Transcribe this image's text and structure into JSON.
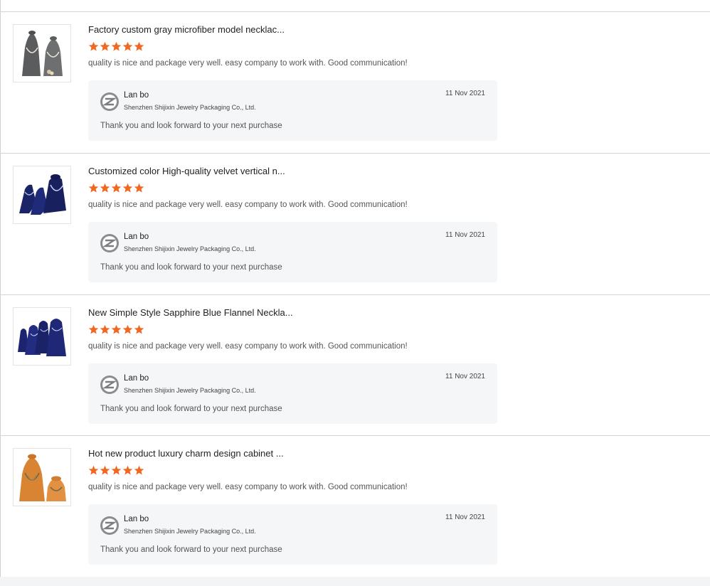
{
  "reviews": [
    {
      "product_title": "Factory custom gray microfiber model necklac...",
      "rating": 5,
      "comment": "quality is nice and package very well. easy company to work with. Good communication!",
      "reply": {
        "seller_name": "Lan bo",
        "company": "Shenzhen Shijixin Jewelry Packaging Co., Ltd.",
        "date": "11 Nov 2021",
        "text": "Thank you and look forward to your next purchase"
      }
    },
    {
      "product_title": "Customized color High-quality velvet vertical n...",
      "rating": 5,
      "comment": "quality is nice and package very well. easy company to work with. Good communication!",
      "reply": {
        "seller_name": "Lan bo",
        "company": "Shenzhen Shijixin Jewelry Packaging Co., Ltd.",
        "date": "11 Nov 2021",
        "text": "Thank you and look forward to your next purchase"
      }
    },
    {
      "product_title": "New Simple Style Sapphire Blue Flannel Neckla...",
      "rating": 5,
      "comment": "quality is nice and package very well. easy company to work with. Good communication!",
      "reply": {
        "seller_name": "Lan bo",
        "company": "Shenzhen Shijixin Jewelry Packaging Co., Ltd.",
        "date": "11 Nov 2021",
        "text": "Thank you and look forward to your next purchase"
      }
    },
    {
      "product_title": "Hot new product luxury charm design cabinet ...",
      "rating": 5,
      "comment": "quality is nice and package very well. easy company to work with. Good communication!",
      "reply": {
        "seller_name": "Lan bo",
        "company": "Shenzhen Shijixin Jewelry Packaging Co., Ltd.",
        "date": "11 Nov 2021",
        "text": "Thank you and look forward to your next purchase"
      }
    }
  ],
  "colors": {
    "star": "#f26722",
    "reply_bg": "#f5f6f8",
    "divider": "#d4d4d4"
  },
  "icons": {
    "thumbnails": [
      "gray-necklace-display-image",
      "navy-velvet-bust-image",
      "sapphire-flannel-set-image",
      "orange-leather-bust-image"
    ],
    "avatar": "seller-logo-avatar",
    "rating": "star-icon"
  }
}
